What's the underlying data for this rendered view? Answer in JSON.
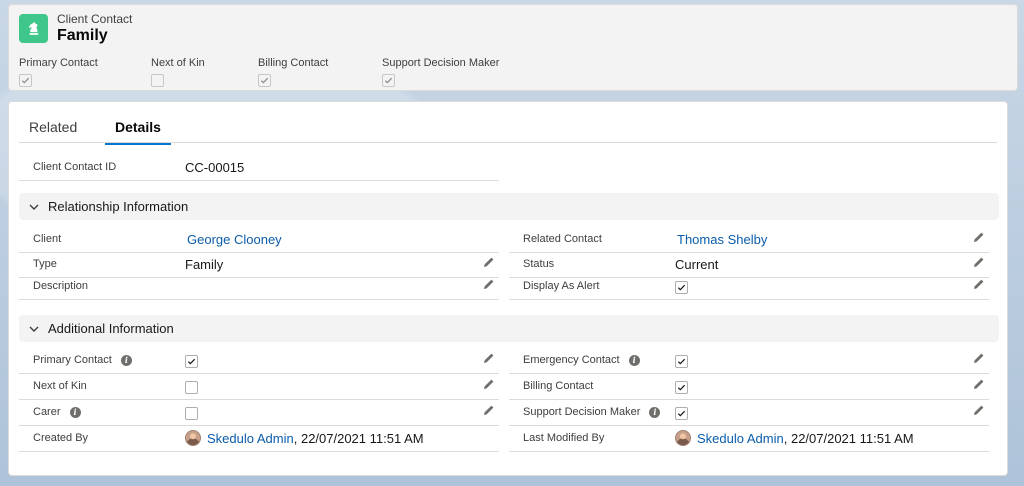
{
  "header": {
    "object_type": "Client Contact",
    "record_name": "Family",
    "icon": "chess-knight-icon",
    "fields": [
      {
        "label": "Primary Contact",
        "checked": true
      },
      {
        "label": "Next of Kin",
        "checked": false
      },
      {
        "label": "Billing Contact",
        "checked": true
      },
      {
        "label": "Support Decision Maker",
        "checked": true
      }
    ]
  },
  "tabs": {
    "related": "Related",
    "details": "Details",
    "active": "Details"
  },
  "details": {
    "client_contact_id": {
      "label": "Client Contact ID",
      "value": "CC-00015"
    }
  },
  "relationship": {
    "title": "Relationship Information",
    "client": {
      "label": "Client",
      "value": "George Clooney"
    },
    "related_contact": {
      "label": "Related Contact",
      "value": "Thomas Shelby"
    },
    "type": {
      "label": "Type",
      "value": "Family"
    },
    "status": {
      "label": "Status",
      "value": "Current"
    },
    "description": {
      "label": "Description",
      "value": ""
    },
    "display_as_alert": {
      "label": "Display As Alert",
      "checked": true
    }
  },
  "additional": {
    "title": "Additional Information",
    "primary_contact": {
      "label": "Primary Contact",
      "checked": true
    },
    "emergency_contact": {
      "label": "Emergency Contact",
      "checked": true
    },
    "next_of_kin": {
      "label": "Next of Kin",
      "checked": false
    },
    "billing_contact": {
      "label": "Billing Contact",
      "checked": true
    },
    "carer": {
      "label": "Carer",
      "checked": false
    },
    "support_decision_maker": {
      "label": "Support Decision Maker",
      "checked": true
    },
    "created_by": {
      "label": "Created By",
      "user": "Skedulo Admin",
      "date": ", 22/07/2021 11:51 AM"
    },
    "last_modified_by": {
      "label": "Last Modified By",
      "user": "Skedulo Admin",
      "date": ", 22/07/2021 11:51 AM"
    }
  },
  "colors": {
    "brand_link": "#0b5cab",
    "tab_active": "#0176d3",
    "object_icon_bg": "#3fc68a"
  }
}
